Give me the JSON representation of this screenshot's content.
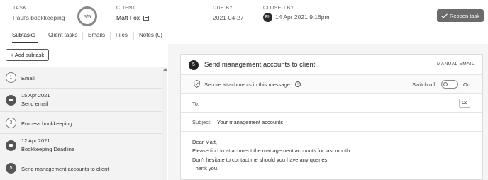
{
  "header": {
    "task_label": "TASK",
    "task_value": "Paul's bookkeeping",
    "progress": "5/5",
    "progress_fraction": 1.0,
    "client_label": "CLIENT",
    "client_value": "Matt Fox",
    "due_label": "DUE BY",
    "due_value": "2021-04-27",
    "closed_label": "CLOSED BY",
    "closed_avatar": "PH",
    "closed_value": "14 Apr 2021 9:16pm",
    "reopen_label": "Reopen task"
  },
  "tabs": [
    {
      "label": "Subtasks",
      "active": true
    },
    {
      "label": "Client tasks"
    },
    {
      "label": "Emails"
    },
    {
      "label": "Files"
    },
    {
      "label": "Notes (0)"
    }
  ],
  "add_subtask_label": "+ Add subtask",
  "subtasks": [
    {
      "marker": "1",
      "line1": "Email"
    },
    {
      "marker": "msg-icon",
      "line1": "15 Apr 2021",
      "line2": "Send email"
    },
    {
      "marker": "3",
      "line1": "Process bookkeeping"
    },
    {
      "marker": "msg-icon",
      "line1": "12 Apr 2021",
      "line2": "Bookkeeping Deadline"
    },
    {
      "marker": "5",
      "line1": "Send management accounts to client"
    }
  ],
  "detail": {
    "step": "5",
    "title": "Send management accounts to client",
    "tag": "MANUAL EMAIL",
    "secure_text": "Secure attachments in this message",
    "switch_off_label": "Switch off",
    "on_label": "On",
    "to_label": "To:",
    "cc_label": "Cc",
    "subject_label": "Subject:",
    "subject_value": "Your management accounts",
    "body_lines": [
      "Dear Matt,",
      "Please find in attachment the management accounts for last month.",
      "Don't hesitate to contact me should you have any queries.",
      "Thank you."
    ]
  }
}
